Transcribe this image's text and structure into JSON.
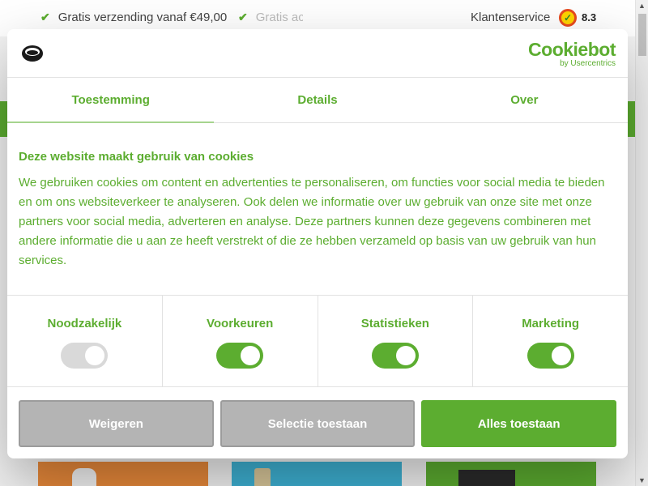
{
  "site": {
    "usp_1": "Gratis verzending vanaf €49,00",
    "usp_2": "Gratis ac",
    "customer_service": "Klantenservice",
    "rating": "8.3"
  },
  "dialog": {
    "provider_name": "Cookiebot",
    "provider_sub": "by Usercentrics",
    "tabs": [
      {
        "label": "Toestemming"
      },
      {
        "label": "Details"
      },
      {
        "label": "Over"
      }
    ],
    "heading": "Deze website maakt gebruik van cookies",
    "body": "We gebruiken cookies om content en advertenties te personaliseren, om functies voor social media te bieden en om ons websiteverkeer te analyseren. Ook delen we informatie over uw gebruik van onze site met onze partners voor social media, adverteren en analyse. Deze partners kunnen deze gegevens combineren met andere informatie die u aan ze heeft verstrekt of die ze hebben verzameld op basis van uw gebruik van hun services.",
    "categories": [
      {
        "label": "Noodzakelijk",
        "enabled": true,
        "disabled": true
      },
      {
        "label": "Voorkeuren",
        "enabled": true,
        "disabled": false
      },
      {
        "label": "Statistieken",
        "enabled": true,
        "disabled": false
      },
      {
        "label": "Marketing",
        "enabled": true,
        "disabled": false
      }
    ],
    "buttons": {
      "deny": "Weigeren",
      "allow_selection": "Selectie toestaan",
      "allow_all": "Alles toestaan"
    }
  },
  "colors": {
    "brand_green": "#5cad30",
    "button_grey": "#b4b4b4"
  },
  "icons": {
    "usp_check": "check-icon",
    "rating_badge": "check-badge-icon",
    "site_logo": "site-logo-icon"
  }
}
